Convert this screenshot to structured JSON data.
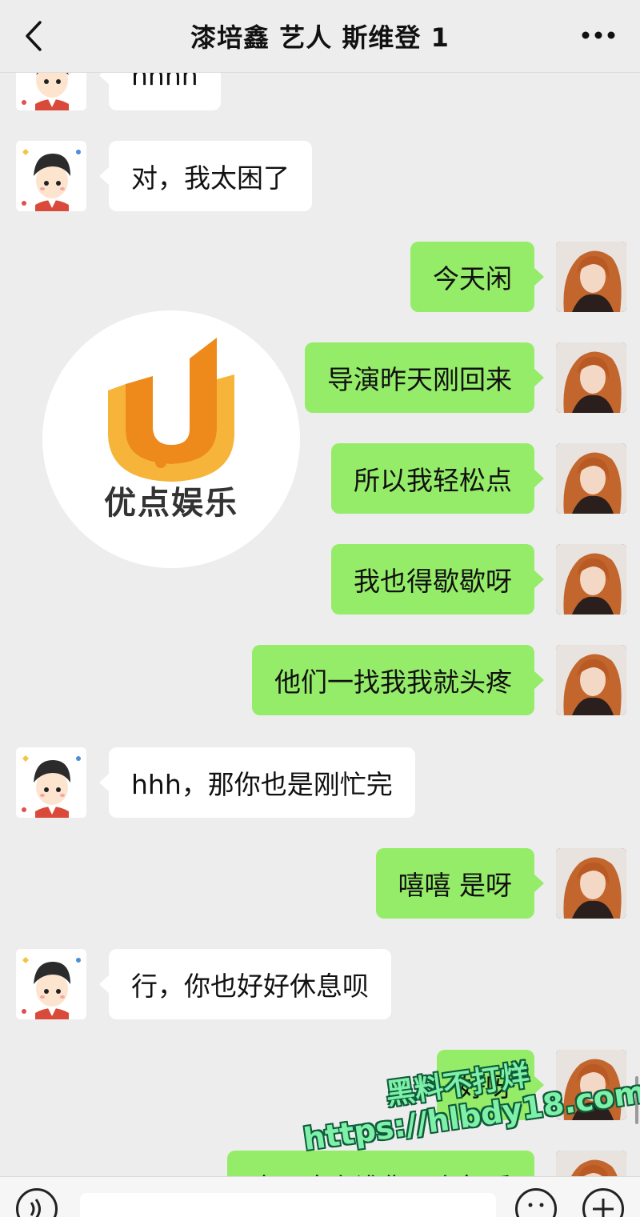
{
  "header": {
    "title": "漆培鑫 艺人 斯维登 1"
  },
  "messages": [
    {
      "side": "in",
      "text": "hhhh"
    },
    {
      "side": "in",
      "text": "对，我太困了"
    },
    {
      "side": "out",
      "text": "今天闲"
    },
    {
      "side": "out",
      "text": "导演昨天刚回来"
    },
    {
      "side": "out",
      "text": "所以我轻松点"
    },
    {
      "side": "out",
      "text": "我也得歇歇呀"
    },
    {
      "side": "out",
      "text": "他们一找我我就头疼"
    },
    {
      "side": "in",
      "text": "hhh，那你也是刚忙完"
    },
    {
      "side": "out",
      "text": "嘻嘻 是呀"
    },
    {
      "side": "in",
      "text": "行，你也好好休息呗"
    },
    {
      "side": "out",
      "text": "好呀"
    },
    {
      "side": "out",
      "text": "昨天晚上谁你...上午睡"
    }
  ],
  "logo": {
    "text": "优点娱乐",
    "colors": {
      "primary": "#ee8a1c",
      "secondary": "#f6b53a"
    }
  },
  "watermark": {
    "line1": "黑料不打烊",
    "line2": "https://hlbdy18.com"
  },
  "colors": {
    "bubble_out": "#95ec69",
    "bubble_in": "#ffffff",
    "background": "#ededed"
  }
}
